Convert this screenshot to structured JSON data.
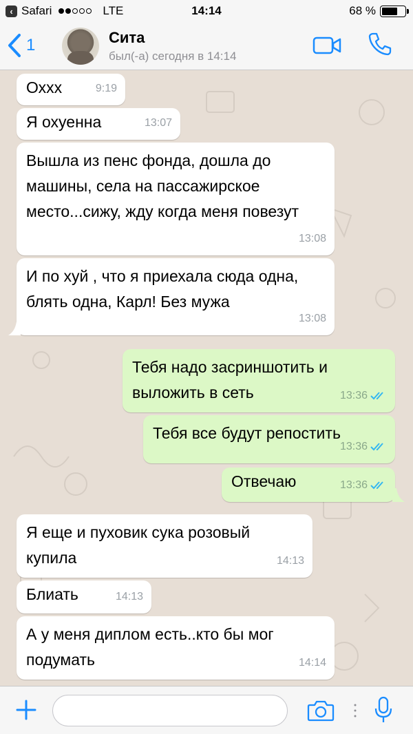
{
  "status_bar": {
    "app": "Safari",
    "network": "LTE",
    "time": "14:14",
    "battery": "68 %",
    "battery_level": 0.68
  },
  "header": {
    "back_count": "1",
    "contact_name": "Сита",
    "contact_status": "был(-а) сегодня в 14:14"
  },
  "messages": [
    {
      "direction": "in",
      "text": "Охxx",
      "time": "9:19"
    },
    {
      "direction": "in",
      "text": "Я охуенна",
      "time": "13:07"
    },
    {
      "direction": "in",
      "text": "Вышла из пенс фонда, дошла до машины, села на пассажирское место...сижу, жду когда меня повезут",
      "time": "13:08"
    },
    {
      "direction": "in",
      "text": "И по хуй , что я приехала сюда одна, блять одна, Карл! Без мужа",
      "time": "13:08"
    },
    {
      "direction": "out",
      "text": "Тебя надо засриншотить и выложить в сеть",
      "time": "13:36",
      "read": true
    },
    {
      "direction": "out",
      "text": "Тебя все будут репостить",
      "time": "13:36",
      "read": true
    },
    {
      "direction": "out",
      "text": "Отвечаю",
      "time": "13:36",
      "read": true
    },
    {
      "direction": "in",
      "text": "Я еще и пуховик сука розовый купила",
      "time": "14:13"
    },
    {
      "direction": "in",
      "text": "Блиать",
      "time": "14:13"
    },
    {
      "direction": "in",
      "text": "А у меня диплом есть..кто бы мог подумать",
      "time": "14:14"
    }
  ],
  "input": {
    "placeholder": ""
  },
  "icons": {
    "back": "chevron-left-icon",
    "video": "video-camera-icon",
    "phone": "phone-icon",
    "plus": "plus-icon",
    "camera": "camera-icon",
    "mic": "microphone-icon",
    "read_receipt": "double-check-icon"
  },
  "colors": {
    "accent": "#1a8cff",
    "incoming_bubble": "#ffffff",
    "outgoing_bubble": "#dcf8c6",
    "chat_background": "#e7ded5",
    "read_check": "#34b7f1"
  }
}
